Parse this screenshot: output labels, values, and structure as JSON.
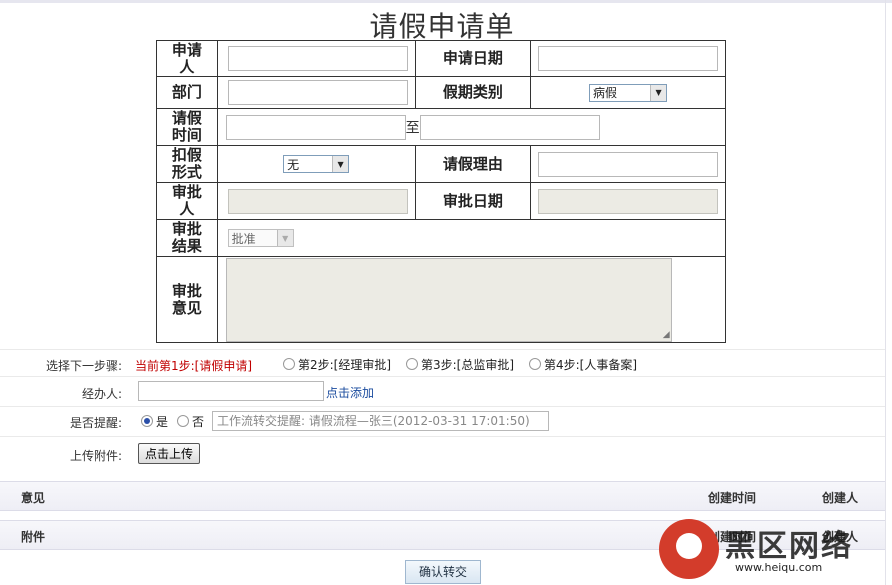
{
  "title": "请假申请单",
  "form": {
    "applicant_label": "申请人",
    "apply_date_label": "申请日期",
    "dept_label": "部门",
    "leave_type_label": "假期类别",
    "leave_type_value": "病假",
    "leave_time_label": "请假时间",
    "to_label": "至",
    "deduct_label": "扣假形式",
    "deduct_value": "无",
    "reason_label": "请假理由",
    "approver_label": "审批人",
    "approve_date_label": "审批日期",
    "result_label": "审批结果",
    "result_value": "批准",
    "opinion_label": "审批意见"
  },
  "workflow": {
    "next_step_label": "选择下一步骤:",
    "current_step": "当前第1步:[请假申请]",
    "steps": [
      "第2步:[经理审批]",
      "第3步:[总监审批]",
      "第4步:[人事备案]"
    ],
    "handler_label": "经办人:",
    "add_link": "点击添加",
    "remind_label": "是否提醒:",
    "yes": "是",
    "no": "否",
    "remind_text": "工作流转交提醒: 请假流程—张三(2012-03-31 17:01:50)",
    "upload_label": "上传附件:",
    "upload_button": "点击上传"
  },
  "opinions_bar": {
    "title": "意见",
    "time": "创建时间",
    "creator": "创建人"
  },
  "attachments_bar": {
    "title": "附件",
    "time": "创建时间",
    "creator": "创建人"
  },
  "confirm_button": "确认转交",
  "watermark": {
    "text": "黑区网络",
    "url": "www.heiqu.com"
  }
}
